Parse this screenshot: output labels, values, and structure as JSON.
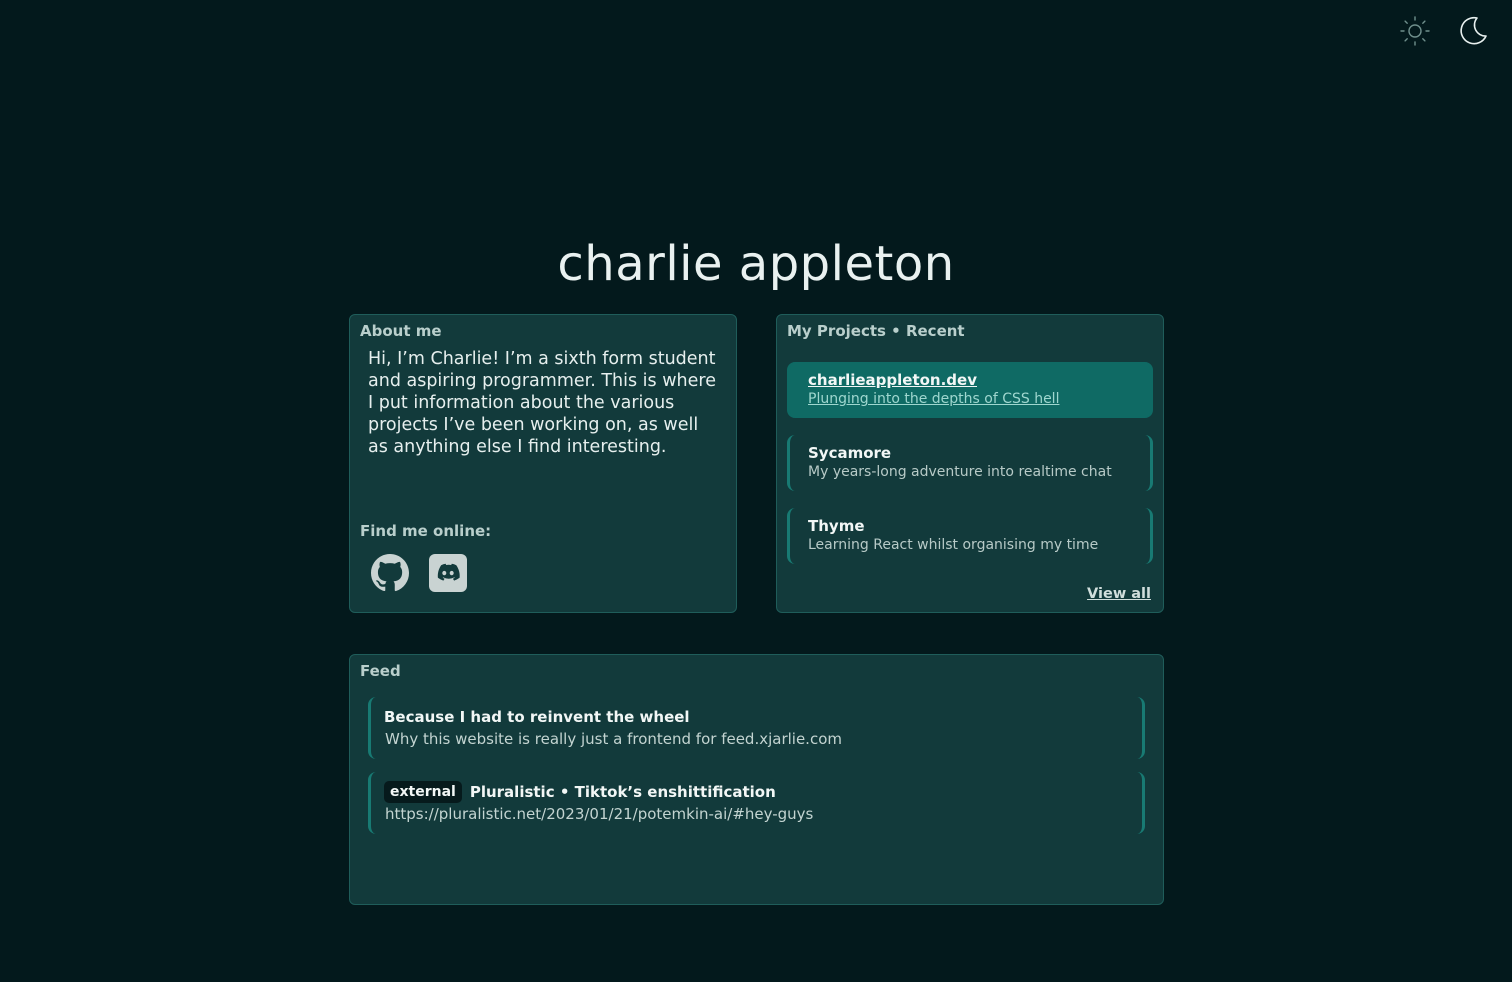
{
  "site": {
    "title": "charlie appleton"
  },
  "theme": {
    "light_icon": "sun-icon",
    "dark_icon": "moon-icon"
  },
  "about": {
    "heading": "About me",
    "text": "Hi, I’m Charlie! I’m a sixth form student and aspiring programmer.  This is where I put information about the various projects I’ve been working on, as well as anything else I find interesting.",
    "find_label": "Find me online:",
    "socials": [
      {
        "name": "github",
        "icon": "github-icon"
      },
      {
        "name": "discord",
        "icon": "discord-icon"
      }
    ]
  },
  "projects": {
    "heading": "My Projects • Recent",
    "items": [
      {
        "name": "charlieappleton.dev",
        "desc": "Plunging into the depths of CSS hell",
        "active": true
      },
      {
        "name": "Sycamore",
        "desc": "My years-long adventure into realtime chat",
        "active": false
      },
      {
        "name": "Thyme",
        "desc": "Learning React whilst organising my time",
        "active": false
      }
    ],
    "view_all": "View all"
  },
  "feed": {
    "heading": "Feed",
    "items": [
      {
        "badge": "",
        "title": "Because I had to reinvent the wheel",
        "sub": "Why this website is really just a frontend for feed.xjarlie.com"
      },
      {
        "badge": "external",
        "title": "Pluralistic • Tiktok’s enshittification",
        "sub": "https://pluralistic.net/2023/01/21/potemkin-ai/#hey-guys"
      }
    ]
  },
  "colors": {
    "background": "#03191c",
    "card": "#123a3b",
    "accent": "#187a73",
    "active": "#0f6a64"
  }
}
